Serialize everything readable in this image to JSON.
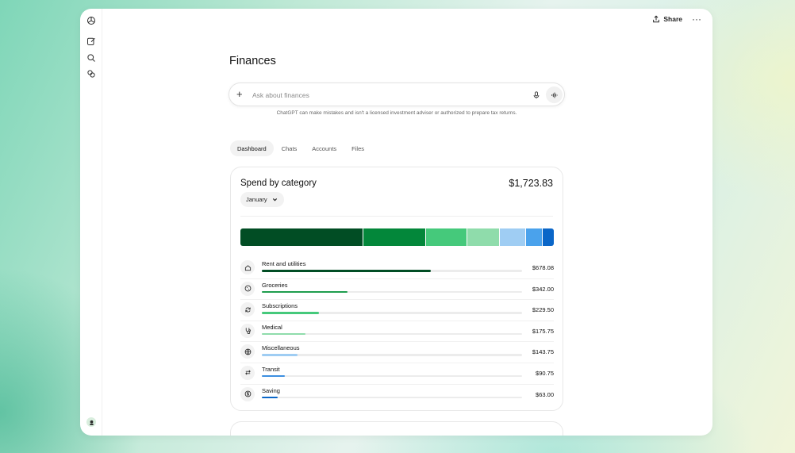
{
  "header": {
    "share_label": "Share",
    "more_label": "···"
  },
  "page": {
    "title": "Finances"
  },
  "search": {
    "placeholder": "Ask about finances",
    "value": "",
    "disclaimer": "ChatGPT can make mistakes and isn't a licensed investment adviser or authorized to prepare tax returns."
  },
  "tabs": [
    {
      "label": "Dashboard",
      "active": true
    },
    {
      "label": "Chats",
      "active": false
    },
    {
      "label": "Accounts",
      "active": false
    },
    {
      "label": "Files",
      "active": false
    }
  ],
  "spend_card": {
    "title": "Spend by category",
    "total": "$1,723.83",
    "month": "January",
    "categories": [
      {
        "name": "Rent and utilities",
        "amount": "$678.08",
        "value": 678.08,
        "color": "#014d24",
        "bar_color": "#014d24",
        "icon": "home-icon"
      },
      {
        "name": "Groceries",
        "amount": "$342.00",
        "value": 342.0,
        "color": "#03873a",
        "bar_color": "#1f9d4e",
        "icon": "cookie-icon"
      },
      {
        "name": "Subscriptions",
        "amount": "$229.50",
        "value": 229.5,
        "color": "#45c97b",
        "bar_color": "#45c97b",
        "icon": "refresh-icon"
      },
      {
        "name": "Medical",
        "amount": "$175.75",
        "value": 175.75,
        "color": "#8fdcab",
        "bar_color": "#8fdcab",
        "icon": "stethoscope-icon"
      },
      {
        "name": "Miscellaneous",
        "amount": "$143.75",
        "value": 143.75,
        "color": "#9fcdf3",
        "bar_color": "#9fcdf3",
        "icon": "globe-icon"
      },
      {
        "name": "Transit",
        "amount": "$90.75",
        "value": 90.75,
        "color": "#4aa2ec",
        "bar_color": "#3d8fe0",
        "icon": "swap-arrows-icon"
      },
      {
        "name": "Saving",
        "amount": "$63.00",
        "value": 63.0,
        "color": "#0a66c8",
        "bar_color": "#0a66c8",
        "icon": "dollar-circle-icon"
      }
    ]
  }
}
